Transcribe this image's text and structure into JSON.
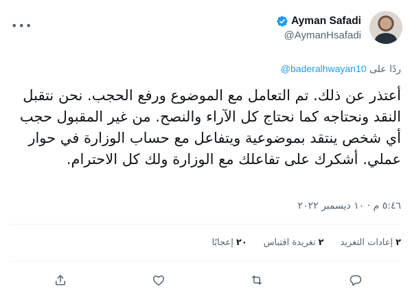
{
  "author": {
    "name": "Ayman Safadi",
    "handle": "@AymanHsafadi",
    "verified_icon": "verified-badge-icon",
    "more_icon": "more-options-icon"
  },
  "reply": {
    "prefix": "ردًا على",
    "mention": "@baderalhwayan10"
  },
  "tweet_text": "أعتذر عن ذلك. تم التعامل مع الموضوع ورفع الحجب. نحن نتقبل النقد ونحتاجه كما نحتاج كل الآراء والنصح. من غير المقبول حجب أي شخص ينتقد بموضوعية ويتفاعل مع حساب الوزارة في حوار عملي. أشكرك على تفاعلك مع الوزارة ولك كل الاحترام.",
  "timestamp": "٥:٤٦ م · ١٠ ديسمبر ٢٠٢٢",
  "stats": {
    "retweets": {
      "count": "٢",
      "label": "إعادات التغريد"
    },
    "quotes": {
      "count": "٢",
      "label": "تغريدة اقتباس"
    },
    "likes": {
      "count": "٢٠",
      "label": "إعجابًا"
    }
  },
  "actions": [
    "reply-icon",
    "retweet-icon",
    "like-icon",
    "share-icon"
  ],
  "colors": {
    "accent": "#1d9bf0",
    "secondary_text": "#536471",
    "primary_text": "#0f1419",
    "divider": "#eff3f4"
  }
}
